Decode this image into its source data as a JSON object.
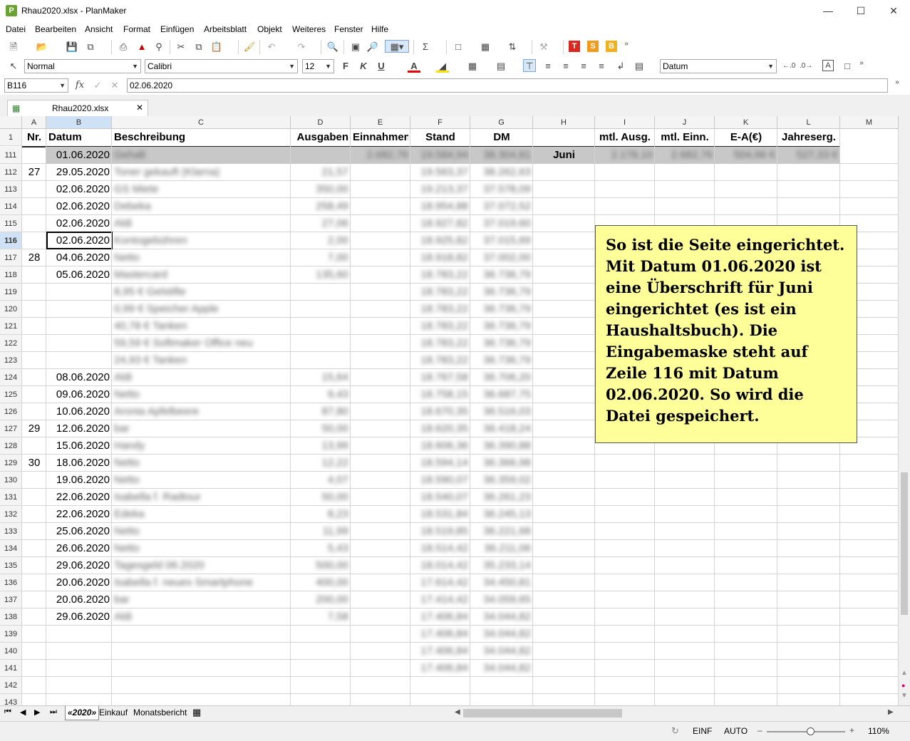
{
  "window": {
    "title": "Rhau2020.xlsx - PlanMaker",
    "app_icon": "P"
  },
  "menu": [
    "Datei",
    "Bearbeiten",
    "Ansicht",
    "Format",
    "Einfügen",
    "Arbeitsblatt",
    "Objekt",
    "Weiteres",
    "Fenster",
    "Hilfe"
  ],
  "format_toolbar": {
    "style": "Normal",
    "font": "Calibri",
    "size": "12",
    "number_format": "Datum"
  },
  "formula_bar": {
    "cell_ref": "B116",
    "fx": "fx",
    "value": "02.06.2020"
  },
  "document_tab": {
    "label": "Rhau2020.xlsx"
  },
  "columns": [
    "A",
    "B",
    "C",
    "D",
    "E",
    "F",
    "G",
    "H",
    "I",
    "J",
    "K",
    "L",
    "M"
  ],
  "header_row": {
    "num": "1",
    "cells": [
      "Nr.",
      "Datum",
      "Beschreibung",
      "Ausgaben",
      "Einnahmen",
      "Stand",
      "DM",
      "",
      "mtl. Ausg.",
      "mtl. Einn.",
      "E-A(€)",
      "Jahreserg."
    ]
  },
  "rows": [
    {
      "num": "111",
      "a": "",
      "b": "01.06.2020",
      "c": "Gehalt",
      "d": "",
      "e": "2.682,76",
      "f": "19.584,94",
      "g": "38.304,81",
      "h": "Juni",
      "i": "2.178,10",
      "j": "2.682,76",
      "k": "504,66 €",
      "l": "527,33 €"
    },
    {
      "num": "112",
      "a": "27",
      "b": "29.05.2020",
      "c": "Toner gekauft (Klarna)",
      "d": "21,57",
      "f": "19.563,37",
      "g": "38.262,63"
    },
    {
      "num": "113",
      "a": "",
      "b": "02.06.2020",
      "c": "GS Miete",
      "d": "350,00",
      "f": "19.213,37",
      "g": "37.578,09"
    },
    {
      "num": "114",
      "a": "",
      "b": "02.06.2020",
      "c": "Debeka",
      "d": "258,49",
      "f": "18.954,88",
      "g": "37.072,52"
    },
    {
      "num": "115",
      "a": "",
      "b": "02.06.2020",
      "c": "Aldi",
      "d": "27,06",
      "f": "18.927,82",
      "g": "37.019,60"
    },
    {
      "num": "116",
      "a": "",
      "b": "02.06.2020",
      "c": "Kontogebühren",
      "d": "2,00",
      "f": "18.925,82",
      "g": "37.015,69"
    },
    {
      "num": "117",
      "a": "28",
      "b": "04.06.2020",
      "c": "Netto",
      "d": "7,00",
      "f": "18.918,82",
      "g": "37.002,00"
    },
    {
      "num": "118",
      "a": "",
      "b": "05.06.2020",
      "c": "Mastercard",
      "d": "135,60",
      "f": "18.783,22",
      "g": "36.736,79"
    },
    {
      "num": "119",
      "a": "",
      "b": "",
      "c": "8,95 € Gelstifte",
      "d": "",
      "f": "18.783,22",
      "g": "36.736,79"
    },
    {
      "num": "120",
      "a": "",
      "b": "",
      "c": "0,99 € Speicher Apple",
      "d": "",
      "f": "18.783,22",
      "g": "36.736,79"
    },
    {
      "num": "121",
      "a": "",
      "b": "",
      "c": "40,78 € Tanken",
      "d": "",
      "f": "18.783,22",
      "g": "36.736,79"
    },
    {
      "num": "122",
      "a": "",
      "b": "",
      "c": "59,59 € Softmaker Office neu",
      "d": "",
      "f": "18.783,22",
      "g": "36.736,79"
    },
    {
      "num": "123",
      "a": "",
      "b": "",
      "c": "24,93 € Tanken",
      "d": "",
      "f": "18.783,22",
      "g": "36.736,79"
    },
    {
      "num": "124",
      "a": "",
      "b": "08.06.2020",
      "c": "Aldi",
      "d": "15,64",
      "f": "18.767,58",
      "g": "36.706,20"
    },
    {
      "num": "125",
      "a": "",
      "b": "09.06.2020",
      "c": "Netto",
      "d": "9,43",
      "f": "18.758,15",
      "g": "36.687,75"
    },
    {
      "num": "126",
      "a": "",
      "b": "10.06.2020",
      "c": "Aronia Apfelbeere",
      "d": "87,80",
      "f": "18.670,35",
      "g": "36.516,03"
    },
    {
      "num": "127",
      "a": "29",
      "b": "12.06.2020",
      "c": "bar",
      "d": "50,00",
      "f": "18.620,35",
      "g": "36.418,24"
    },
    {
      "num": "128",
      "a": "",
      "b": "15.06.2020",
      "c": "Handy",
      "d": "13,99",
      "f": "18.606,36",
      "g": "36.390,88"
    },
    {
      "num": "129",
      "a": "30",
      "b": "18.06.2020",
      "c": "Netto",
      "d": "12,22",
      "f": "18.594,14",
      "g": "36.366,98"
    },
    {
      "num": "130",
      "a": "",
      "b": "19.06.2020",
      "c": "Netto",
      "d": "4,07",
      "f": "18.590,07",
      "g": "36.359,02"
    },
    {
      "num": "131",
      "a": "",
      "b": "22.06.2020",
      "c": "Isabella f. Radtour",
      "d": "50,00",
      "f": "18.540,07",
      "g": "36.261,23"
    },
    {
      "num": "132",
      "a": "",
      "b": "22.06.2020",
      "c": "Edeka",
      "d": "8,23",
      "f": "18.531,84",
      "g": "36.245,13"
    },
    {
      "num": "133",
      "a": "",
      "b": "25.06.2020",
      "c": "Netto",
      "d": "11,99",
      "f": "18.519,85",
      "g": "36.221,68"
    },
    {
      "num": "134",
      "a": "",
      "b": "26.06.2020",
      "c": "Netto",
      "d": "5,43",
      "f": "18.514,42",
      "g": "36.211,06"
    },
    {
      "num": "135",
      "a": "",
      "b": "29.06.2020",
      "c": "Tagesgeld 06.2020",
      "d": "500,00",
      "f": "18.014,42",
      "g": "35.233,14"
    },
    {
      "num": "136",
      "a": "",
      "b": "20.06.2020",
      "c": "Isabella f. neues Smartphone",
      "d": "400,00",
      "f": "17.614,42",
      "g": "34.450,81"
    },
    {
      "num": "137",
      "a": "",
      "b": "20.06.2020",
      "c": "bar",
      "d": "200,00",
      "f": "17.414,42",
      "g": "34.059,65"
    },
    {
      "num": "138",
      "a": "",
      "b": "29.06.2020",
      "c": "Aldi",
      "d": "7,58",
      "f": "17.406,84",
      "g": "34.044,82"
    },
    {
      "num": "139",
      "a": "",
      "b": "",
      "c": "",
      "d": "",
      "f": "17.406,84",
      "g": "34.044,82"
    },
    {
      "num": "140",
      "a": "",
      "b": "",
      "c": "",
      "d": "",
      "f": "17.406,84",
      "g": "34.044,82"
    },
    {
      "num": "141",
      "a": "",
      "b": "",
      "c": "",
      "d": "",
      "f": "17.406,84",
      "g": "34.044,82"
    },
    {
      "num": "142",
      "a": "",
      "b": "",
      "c": "",
      "d": "",
      "f": "",
      "g": ""
    },
    {
      "num": "143",
      "a": "",
      "b": "",
      "c": "",
      "d": "",
      "f": "",
      "g": ""
    }
  ],
  "callout": {
    "text": "So ist die Seite eingerichtet. Mit Datum 01.06.2020 ist eine Überschrift für Juni eingerichtet (es ist ein Haushaltsbuch). Die Eingabemaske steht auf Zeile 116 mit Datum 02.06.2020. So wird die Datei gespeichert."
  },
  "sheet_tabs": [
    "«2020»",
    "Einkauf",
    "Monatsbericht"
  ],
  "status": {
    "mode": "EINF",
    "calc": "AUTO",
    "zoom": "110%",
    "zoom_level": 0.55
  }
}
